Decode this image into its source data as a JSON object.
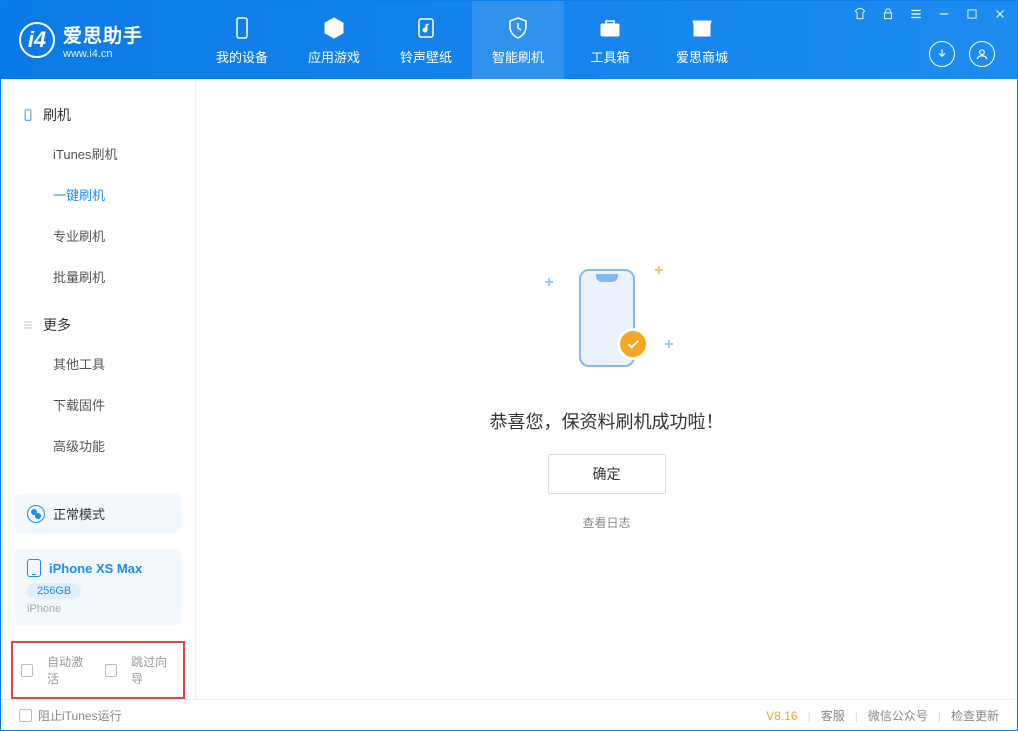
{
  "app": {
    "name_cn": "爱思助手",
    "name_en": "www.i4.cn"
  },
  "nav": {
    "items": [
      {
        "label": "我的设备",
        "icon": "device"
      },
      {
        "label": "应用游戏",
        "icon": "cube"
      },
      {
        "label": "铃声壁纸",
        "icon": "music"
      },
      {
        "label": "智能刷机",
        "icon": "shield",
        "active": true
      },
      {
        "label": "工具箱",
        "icon": "toolbox"
      },
      {
        "label": "爱思商城",
        "icon": "store"
      }
    ]
  },
  "sidebar": {
    "group1_title": "刷机",
    "group1_items": [
      "iTunes刷机",
      "一键刷机",
      "专业刷机",
      "批量刷机"
    ],
    "group1_active": 1,
    "group2_title": "更多",
    "group2_items": [
      "其他工具",
      "下载固件",
      "高级功能"
    ],
    "mode_label": "正常模式",
    "device": {
      "name": "iPhone XS Max",
      "storage": "256GB",
      "type": "iPhone"
    },
    "opts": {
      "auto_activate": "自动激活",
      "skip_guide": "跳过向导"
    }
  },
  "main": {
    "success_msg": "恭喜您，保资料刷机成功啦！",
    "ok_button": "确定",
    "view_log": "查看日志"
  },
  "statusbar": {
    "block_itunes": "阻止iTunes运行",
    "version": "V8.16",
    "links": [
      "客服",
      "微信公众号",
      "检查更新"
    ]
  }
}
